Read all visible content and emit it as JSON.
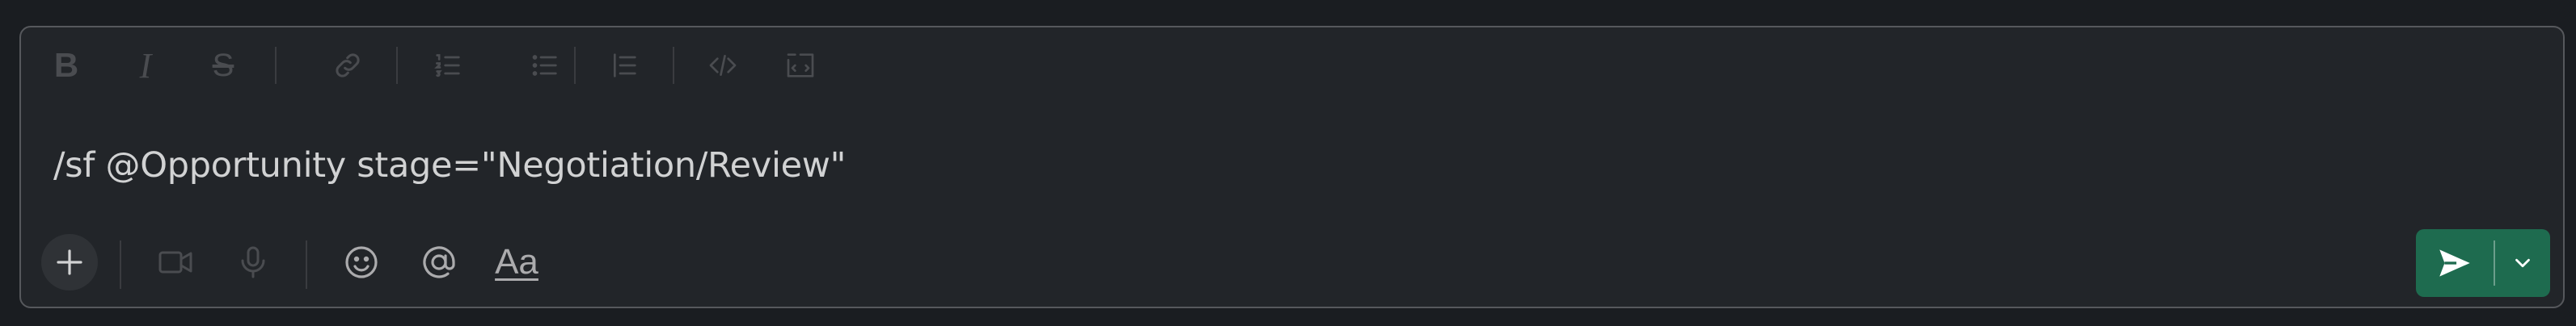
{
  "composer": {
    "message_text": "/sf @Opportunity stage=\"Negotiation/Review\"",
    "formatting_toolbar": {
      "bold_label": "B",
      "italic_label": "I",
      "strikethrough_label": "S",
      "icons": [
        "bold-icon",
        "italic-icon",
        "strikethrough-icon",
        "link-icon",
        "ordered-list-icon",
        "bulleted-list-icon",
        "blockquote-icon",
        "code-icon",
        "code-block-icon"
      ]
    },
    "action_bar": {
      "icons": [
        "plus-icon",
        "video-icon",
        "microphone-icon",
        "emoji-icon",
        "mention-icon",
        "formatting-icon"
      ],
      "formatting_label": "Aa"
    },
    "send": {
      "icons": [
        "send-icon",
        "chevron-down-icon"
      ],
      "accent_color": "#1e6b4f"
    }
  },
  "colors": {
    "background": "#1a1d21",
    "composer_background": "#222529",
    "border": "#56585c",
    "text": "#d1d2d3",
    "disabled_icon": "#4a4c50"
  }
}
